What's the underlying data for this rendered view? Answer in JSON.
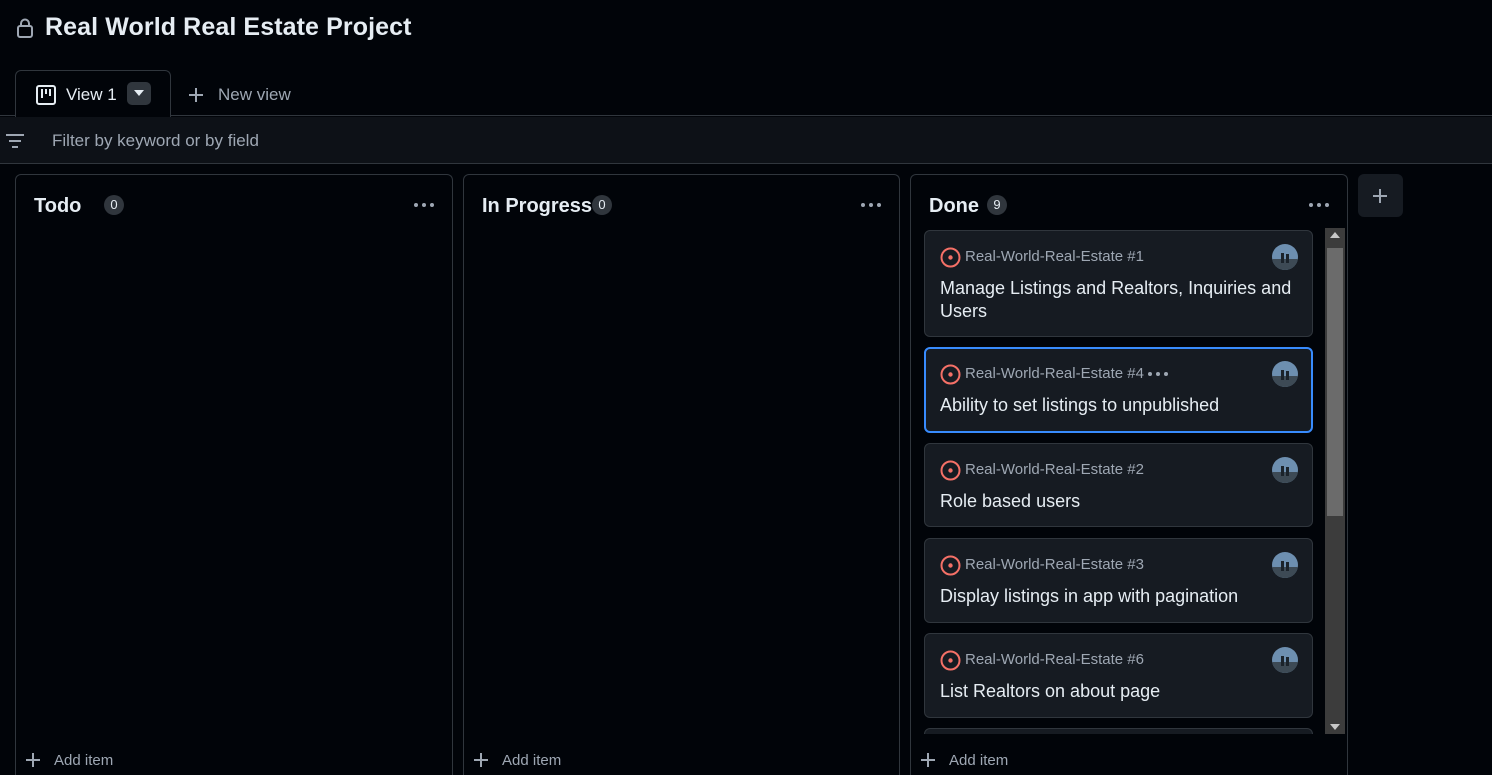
{
  "project": {
    "title": "Real World Real Estate Project",
    "lock_icon": "lock-icon"
  },
  "tabs": {
    "active": {
      "label": "View 1",
      "icon": "board-icon"
    },
    "new_view_label": "New view"
  },
  "filter": {
    "placeholder": "Filter by keyword or by field",
    "value": ""
  },
  "columns": [
    {
      "title": "Todo",
      "count": "0",
      "add_label": "Add item"
    },
    {
      "title": "In Progress",
      "count": "0",
      "add_label": "Add item"
    },
    {
      "title": "Done",
      "count": "9",
      "add_label": "Add item"
    }
  ],
  "done_cards": [
    {
      "repo": "Real-World-Real-Estate #1",
      "title": "Manage Listings and Realtors, Inquiries and Users",
      "selected": false
    },
    {
      "repo": "Real-World-Real-Estate #4",
      "title": "Ability to set listings to unpublished",
      "selected": true
    },
    {
      "repo": "Real-World-Real-Estate #2",
      "title": "Role based users",
      "selected": false
    },
    {
      "repo": "Real-World-Real-Estate #3",
      "title": "Display listings in app with pagination",
      "selected": false
    },
    {
      "repo": "Real-World-Real-Estate #6",
      "title": "List Realtors on about page",
      "selected": false
    }
  ],
  "colors": {
    "background": "#010409",
    "surface": "#161b22",
    "border": "#30363d",
    "accent": "#388bfd",
    "issue_open": "#f47067",
    "muted_text": "#9ea7b3"
  }
}
